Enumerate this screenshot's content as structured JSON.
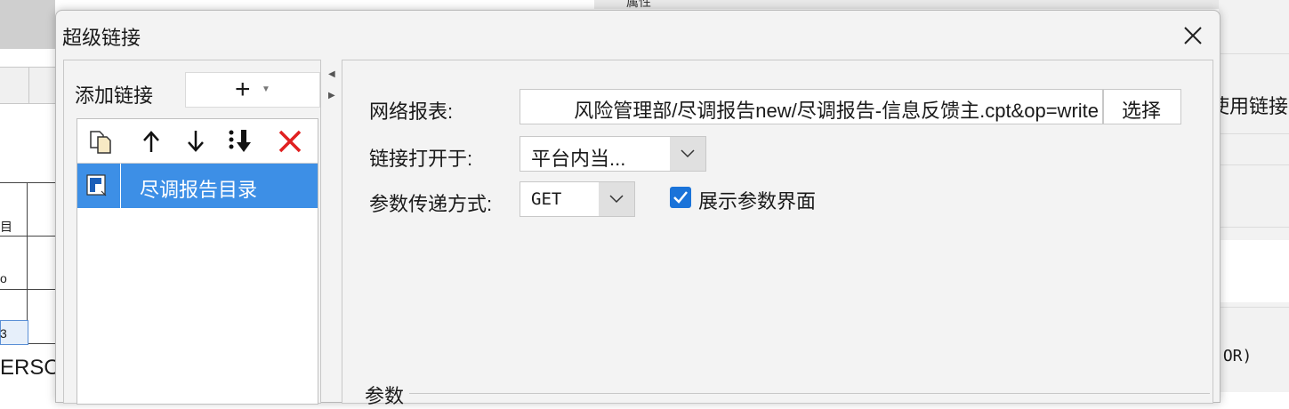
{
  "background": {
    "left_cells": [
      "目",
      "o",
      "3"
    ],
    "left_bottom_text": "ERSO",
    "top_right_label": "属性",
    "right_partial_text": "使用链接",
    "right_or_text": "(OR)"
  },
  "dialog": {
    "title": "超级链接",
    "close_label": "×",
    "left_panel": {
      "add_link_label": "添加链接",
      "add_button_label": "+",
      "toolbar": {
        "copy_tooltip": "copy-icon",
        "up_tooltip": "arrow-up-icon",
        "down_tooltip": "arrow-down-icon",
        "move_bottom_tooltip": "move-to-bottom-icon",
        "delete_tooltip": "delete-icon"
      },
      "items": [
        {
          "label": "尽调报告目录",
          "icon": "report-icon",
          "selected": true
        }
      ]
    },
    "right_panel": {
      "web_report_label": "网络报表:",
      "web_report_value": "风险管理部/尽调报告new/尽调报告-信息反馈主.cpt&op=write",
      "choose_button": "选择",
      "open_in_label": "链接打开于:",
      "open_in_value": "平台内当...",
      "param_method_label": "参数传递方式:",
      "param_method_value": "GET",
      "show_params_label": "展示参数界面",
      "show_params_checked": true,
      "params_section_label": "参数"
    }
  },
  "colors": {
    "selection": "#3d8fe6",
    "checkbox": "#1a73d9",
    "delete": "#e02020",
    "dialog_bg": "#f3f3f3"
  }
}
